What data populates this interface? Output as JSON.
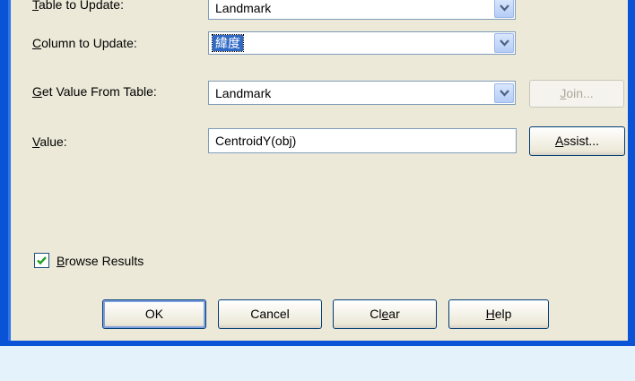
{
  "form": {
    "table_to_update": {
      "label_mnemonic": "T",
      "label_rest": "able to Update:",
      "value": "Landmark"
    },
    "column_to_update": {
      "label_mnemonic": "C",
      "label_rest": "olumn to Update:",
      "value": "緯度"
    },
    "get_value_from_table": {
      "label_mnemonic": "G",
      "label_rest": "et Value From Table:",
      "value": "Landmark"
    },
    "value": {
      "label_mnemonic": "V",
      "label_rest": "alue:",
      "value": "CentroidY(obj)"
    }
  },
  "buttons": {
    "join": {
      "mnemonic": "J",
      "rest": "oin...",
      "enabled": false
    },
    "assist": {
      "mnemonic": "A",
      "rest": "ssist...",
      "enabled": true
    },
    "ok": {
      "label": "OK"
    },
    "cancel": {
      "label": "Cancel"
    },
    "clear": {
      "pre": "Cl",
      "mnemonic": "e",
      "post": "ar"
    },
    "help": {
      "mnemonic": "H",
      "rest": "elp"
    }
  },
  "browse_results": {
    "mnemonic": "B",
    "rest": "rowse Results",
    "checked": true
  },
  "icons": {
    "dropdown": "chevron-down-icon",
    "check": "checkmark-icon"
  },
  "colors": {
    "frame": "#0a52d6",
    "dialog_bg": "#ece9d8",
    "selection": "#316ac5",
    "outside_bg": "#e3f2fb"
  }
}
